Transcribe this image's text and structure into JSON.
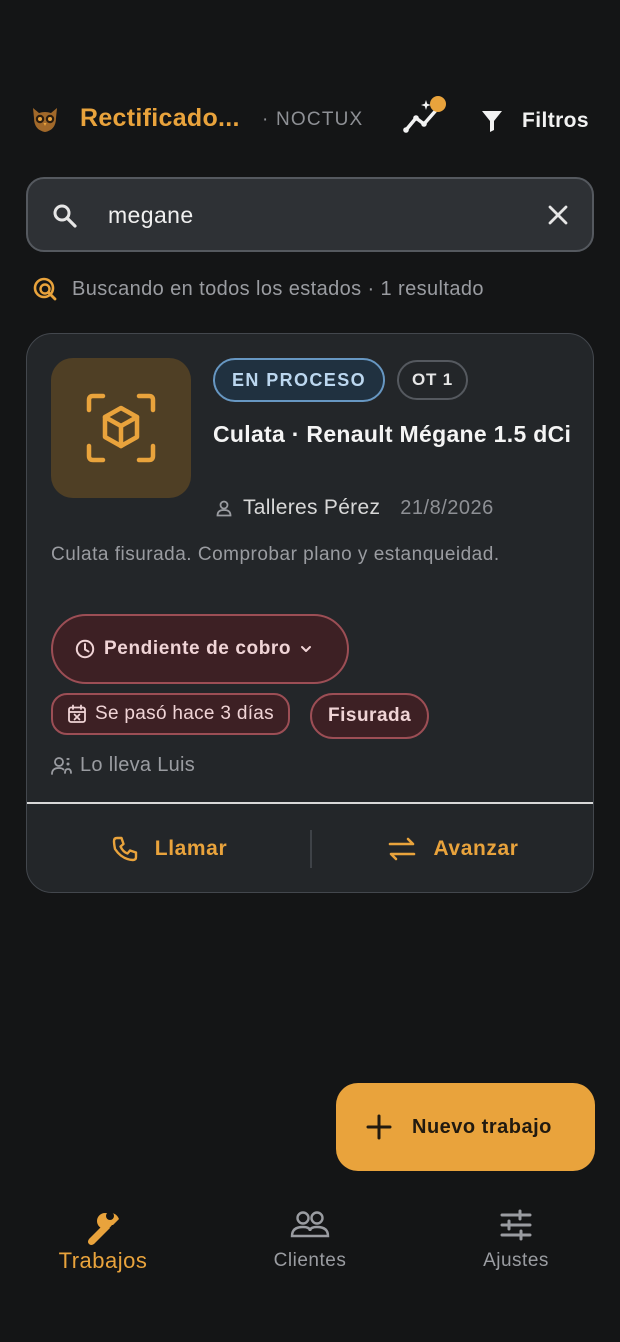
{
  "header": {
    "app_title": "Rectificado...",
    "brand_tag": "· NOCTUX",
    "filter_label": "Filtros"
  },
  "search": {
    "value": "megane",
    "status_text": "Buscando en todos los estados · 1 resultado"
  },
  "job_card": {
    "state_badge": "EN PROCESO",
    "ot_badge": "OT 1",
    "title": "Culata · Renault Mégane 1.5 dCi",
    "client_name": "Talleres Pérez",
    "date": "21/8/2026",
    "description": "Culata fisurada. Comprobar plano y estanqueidad.",
    "payment_status": "Pendiente de cobro",
    "overdue_text": "Se pasó hace 3 días",
    "tag": "Fisurada",
    "assignee": "Lo lleva Luis",
    "actions": {
      "call": "Llamar",
      "advance": "Avanzar"
    }
  },
  "fab": {
    "label": "Nuevo trabajo"
  },
  "bottom_nav": [
    {
      "label": "Trabajos",
      "icon": "wrench-icon",
      "active": true
    },
    {
      "label": "Clientes",
      "icon": "people-icon",
      "active": false
    },
    {
      "label": "Ajustes",
      "icon": "sliders-icon",
      "active": false
    }
  ],
  "colors": {
    "accent": "#e9a33c",
    "background": "#141516",
    "card": "#232629",
    "danger_bg": "#3d2024",
    "danger_border": "#9c4e55",
    "info_border": "#6797c2"
  }
}
